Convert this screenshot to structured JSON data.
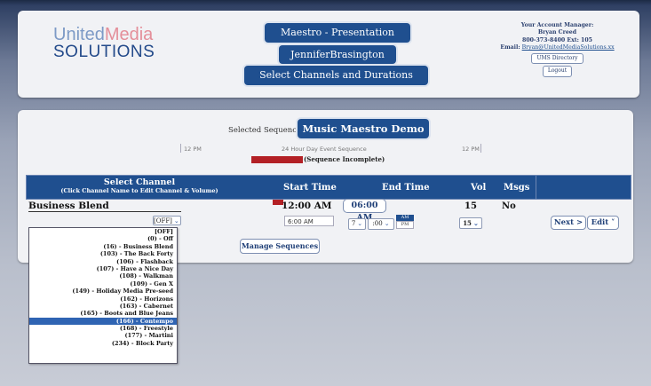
{
  "logo": {
    "line1_a": "United",
    "line1_b": "Media",
    "line2": "SOLUTIONS"
  },
  "header": {
    "presentation": "Maestro - Presentation",
    "user": "JenniferBrasington",
    "section": "Select Channels and Durations"
  },
  "account": {
    "title": "Your Account Manager:",
    "name": "Bryan Creed",
    "phone": "800-373-8400 Ext: 105",
    "email_label": "Email:",
    "email": "Bryan@UnitedMediaSolutions.xx",
    "directory_button": "UMS Directory",
    "logout_button": "Logout"
  },
  "sequence": {
    "label": "Selected Sequence:",
    "name": "Music Maestro Demo",
    "timeline_start": "12 PM",
    "timeline_center": "24 Hour Day Event Sequence",
    "timeline_end": "12 PM",
    "status": "(Sequence Incomplete)"
  },
  "table": {
    "header_channel": "Select Channel",
    "header_channel_hint": "(Click Channel Name to Edit Channel & Volume)",
    "header_start": "Start Time",
    "header_end": "End Time",
    "header_vol": "Vol",
    "header_msgs": "Msgs"
  },
  "row": {
    "channel_name": "Business Blend",
    "start_time": "12:00 AM",
    "end_time": "06:00 AM",
    "vol": "15",
    "msgs": "No",
    "channel_select_value": "[OFF]",
    "start_input_value": "6:00 AM",
    "hour_value": "7",
    "minute_value": ":00",
    "am_label": "AM",
    "pm_label": "PM",
    "vol_select_value": "15",
    "next_button": "Next >",
    "edit_button": "Edit ˅"
  },
  "manage_button": "Manage Sequences",
  "dropdown_options": [
    "[OFF]",
    "(0) - Off",
    "(16) - Business Blend",
    "(103) - The Back Forty",
    "(106) - Flashback",
    "(107) - Have a Nice Day",
    "(108) - Walkman",
    "(109) - Gen X",
    "(149) - Holiday Media Pre-seed",
    "(162) - Horizons",
    "(163) - Cabernet",
    "(165) - Boots and Blue Jeans",
    "(166) - Contempo",
    "(168) - Freestyle",
    "(177) - Martini",
    "(234) - Block Party"
  ],
  "dropdown_highlighted_index": 12,
  "colors": {
    "brand_blue": "#1f4f8f",
    "alert_red": "#b32025",
    "logo_pink": "#e48f9a",
    "logo_light_blue": "#7d9ac6"
  }
}
